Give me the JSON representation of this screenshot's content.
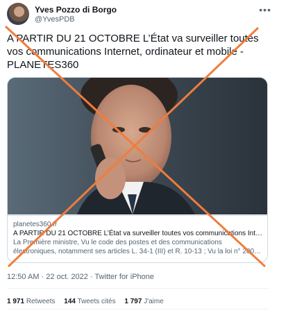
{
  "author": {
    "name": "Yves Pozzo di Borgo",
    "handle": "@YvesPDB"
  },
  "more_icon": "more-horizontal-icon",
  "tweet_text": "A PARTIR DU 21 OCTOBRE L’État va surveiller toutes vos communications Internet, ordinateur et mobile - PLANETES360",
  "card": {
    "domain": "planetes360.fr",
    "title": "A PARTIR DU 21 OCTOBRE L’État va surveiller toutes vos communications Inter…",
    "description": "La Première ministre, Vu le code des postes et des communications électroniques, notamment ses articles L. 34-1 (III) et R. 10-13 ; Vu la loi n° 200…"
  },
  "meta": {
    "time": "12:50 AM",
    "date": "22 oct. 2022",
    "source": "Twitter for iPhone"
  },
  "stats": {
    "retweets_count": "1 971",
    "retweets_label": "Retweets",
    "quotes_count": "144",
    "quotes_label": "Tweets cités",
    "likes_count": "1 797",
    "likes_label": "J'aime"
  },
  "colors": {
    "cross": "#f07d3c",
    "text": "#0f1419",
    "secondary": "#536471",
    "border": "#cfd9de"
  }
}
